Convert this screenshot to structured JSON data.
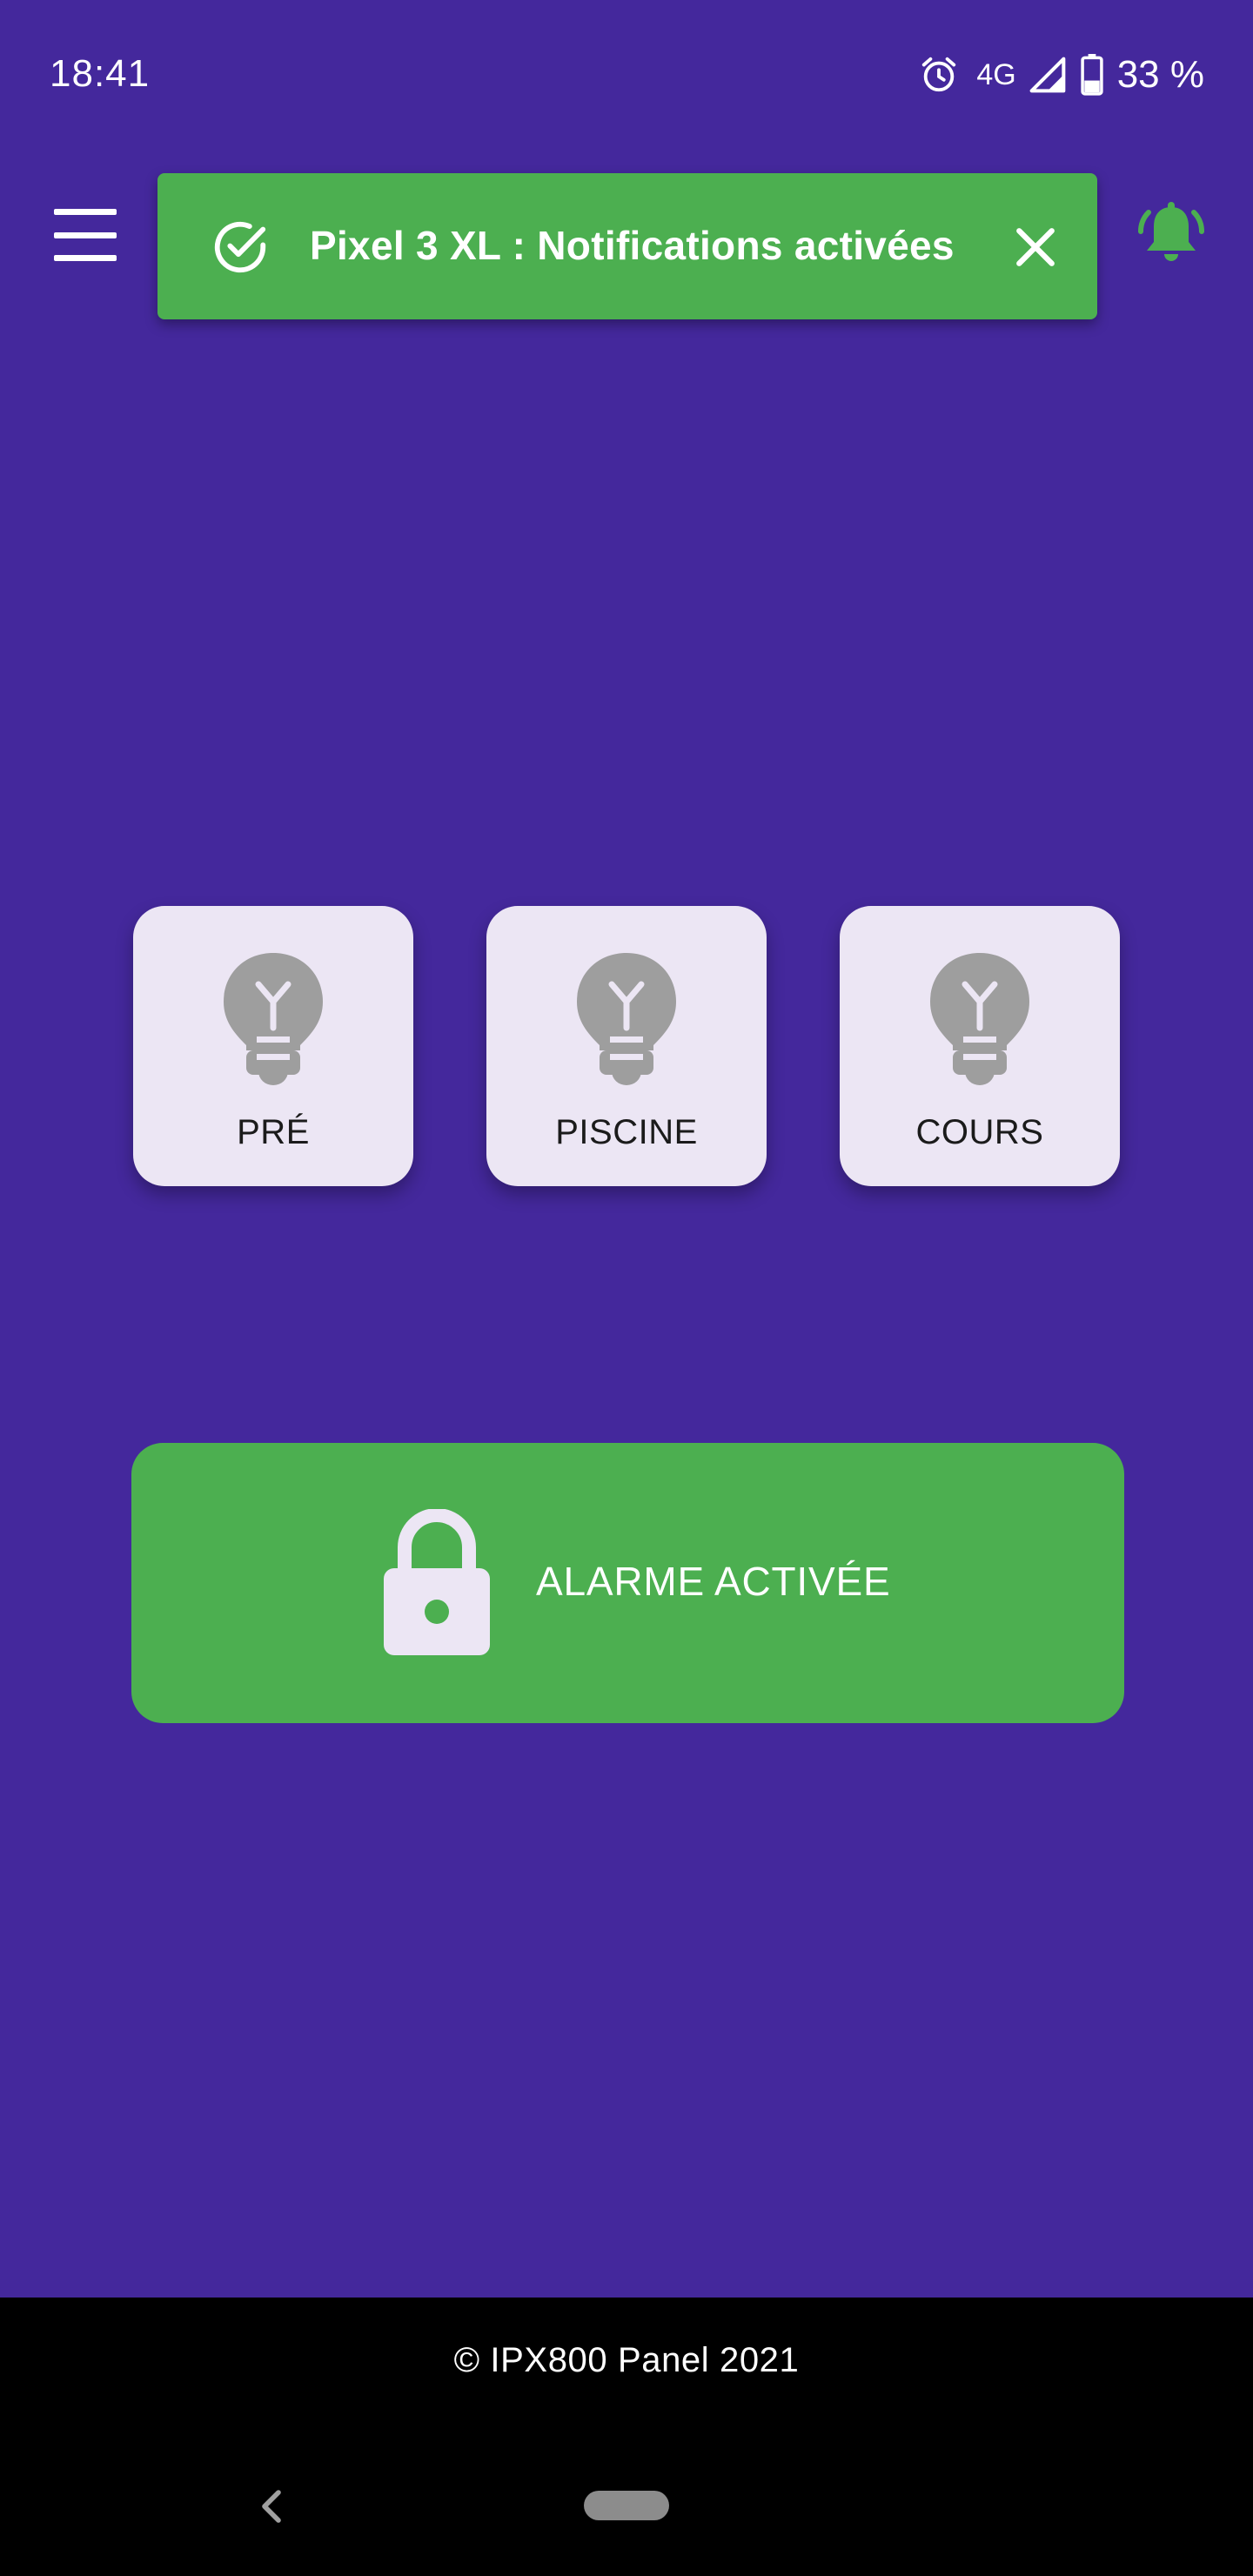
{
  "status_bar": {
    "time": "18:41",
    "network": "4G",
    "battery": "33 %",
    "icons": [
      "alarm-clock-icon",
      "signal-icon",
      "battery-icon"
    ]
  },
  "app_bar": {
    "menu_icon": "hamburger-menu-icon",
    "bell_icon": "bell-ringing-icon",
    "bell_color": "#4caf50"
  },
  "toast": {
    "message": "Pixel 3 XL : Notifications activées",
    "icon": "check-circle-icon",
    "close_icon": "close-icon",
    "color": "#4caf50"
  },
  "tiles": [
    {
      "label": "PRÉ",
      "icon": "lightbulb-icon",
      "state": "off"
    },
    {
      "label": "PISCINE",
      "icon": "lightbulb-icon",
      "state": "off"
    },
    {
      "label": "COURS",
      "icon": "lightbulb-icon",
      "state": "off"
    }
  ],
  "alarm": {
    "label": "ALARME ACTIVÉE",
    "icon": "lock-icon",
    "color": "#4caf50"
  },
  "footer": {
    "text": "© IPX800 Panel 2021"
  },
  "colors": {
    "background": "#44289c",
    "tile_background": "#ece6f4",
    "bulb_off": "#9e9e9e"
  }
}
